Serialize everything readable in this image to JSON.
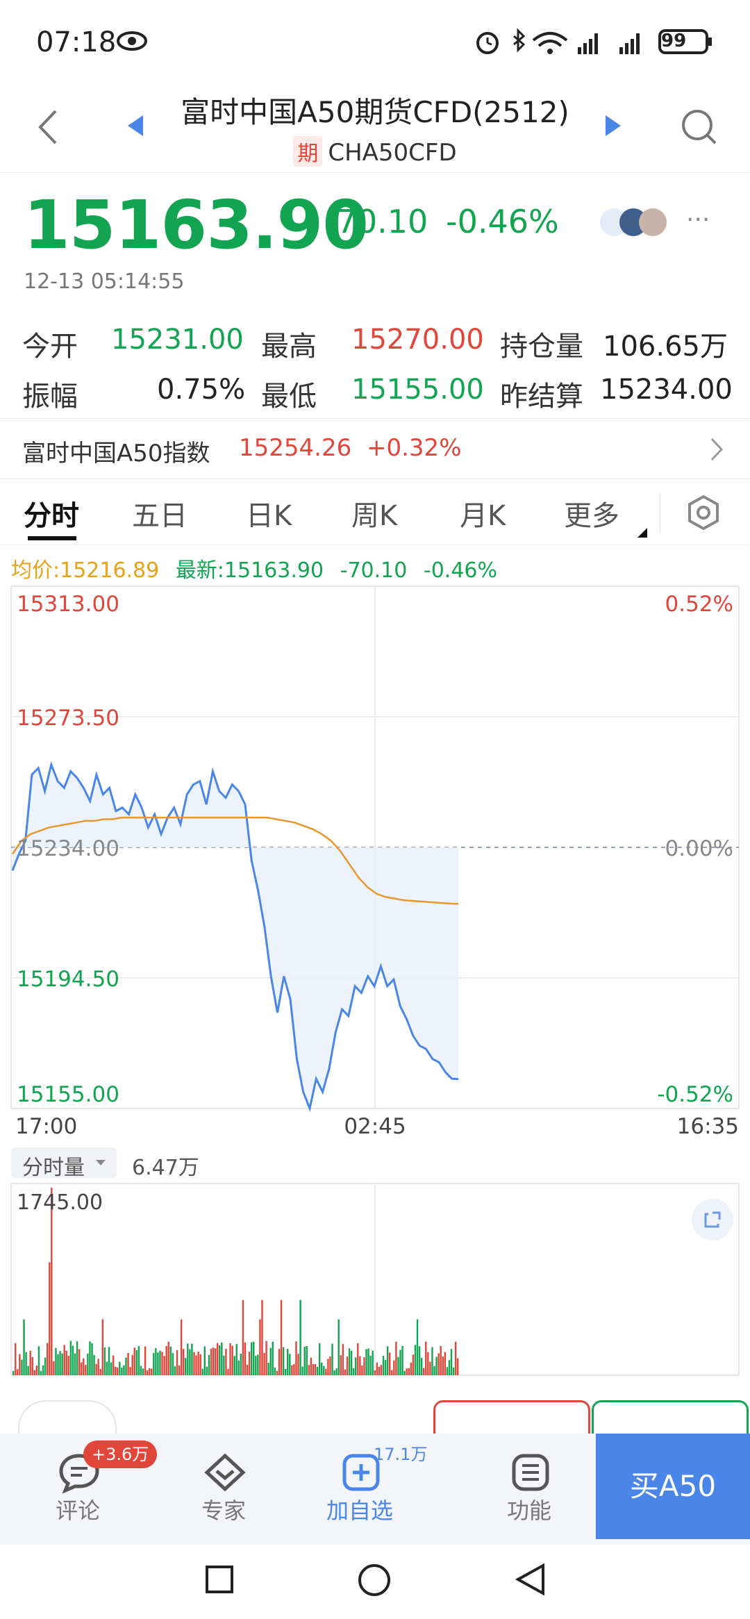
{
  "status_bar": {
    "time": "07:18",
    "battery": "99"
  },
  "header": {
    "title": "富时中国A50期货CFD(2512)",
    "badge": "期",
    "symbol": "CHA50CFD"
  },
  "quote": {
    "price": "15163.90",
    "change": "-70.10",
    "change_pct": "-0.46%",
    "timestamp": "12-13 05:14:55"
  },
  "stats": {
    "open_label": "今开",
    "open": "15231.00",
    "high_label": "最高",
    "high": "15270.00",
    "oi_label": "持仓量",
    "oi": "106.65万",
    "amp_label": "振幅",
    "amp": "0.75%",
    "low_label": "最低",
    "low": "15155.00",
    "prev_label": "昨结算",
    "prev": "15234.00"
  },
  "index_row": {
    "name": "富时中国A50指数",
    "value": "15254.26",
    "pct": "+0.32%"
  },
  "tabs": [
    {
      "label": "分时"
    },
    {
      "label": "五日"
    },
    {
      "label": "日K"
    },
    {
      "label": "周K"
    },
    {
      "label": "月K"
    },
    {
      "label": "更多"
    }
  ],
  "legend": {
    "avg": "均价:15216.89",
    "latest": "最新:15163.90",
    "chg": "-70.10",
    "pct": "-0.46%"
  },
  "volume_header": {
    "selector": "分时量",
    "total": "6.47万",
    "max": "1745.00"
  },
  "colors": {
    "green": "#13a452",
    "red": "#e0473a",
    "price_line": "#4a86e8",
    "avg_line": "#e8962e",
    "brand_blue": "#4a86e8"
  },
  "chart_data": {
    "type": "line",
    "x_ticks": [
      "17:00",
      "02:45",
      "16:35"
    ],
    "y_ticks_left": [
      "15313.00",
      "15273.50",
      "15234.00",
      "15194.50",
      "15155.00"
    ],
    "y_ticks_right": [
      "0.52%",
      "",
      "0.00%",
      "",
      "-0.52%"
    ],
    "ylim": [
      15155,
      15313
    ],
    "reference": 15234.0,
    "series": [
      {
        "role": "price",
        "values": [
          15227,
          15232,
          15236,
          15256,
          15258,
          15251,
          15259,
          15254,
          15252,
          15257,
          15255,
          15252,
          15248,
          15256,
          15250,
          15252,
          15245,
          15246,
          15244,
          15250,
          15246,
          15240,
          15244,
          15238,
          15243,
          15246,
          15241,
          15250,
          15253,
          15254,
          15247,
          15257,
          15251,
          15249,
          15253,
          15251,
          15247,
          15230,
          15221,
          15210,
          15195,
          15184,
          15195,
          15188,
          15170,
          15160,
          15155,
          15164,
          15160,
          15167,
          15178,
          15185,
          15183,
          15192,
          15190,
          15195,
          15192,
          15198,
          15192,
          15194,
          15186,
          15182,
          15177,
          15174,
          15173,
          15170,
          15169,
          15166,
          15164,
          15163.9
        ]
      },
      {
        "role": "average",
        "values": [
          15232,
          15236,
          15238,
          15239,
          15240,
          15240.5,
          15241,
          15241.5,
          15242,
          15242,
          15242.5,
          15242.5,
          15243,
          15243,
          15243,
          15243,
          15243,
          15243,
          15243,
          15243,
          15243,
          15243,
          15243,
          15243,
          15243,
          15243,
          15243,
          15243,
          15243,
          15242.5,
          15242,
          15241.5,
          15240.5,
          15239.5,
          15238,
          15236,
          15233,
          15229,
          15225,
          15222,
          15220,
          15219,
          15218.5,
          15218,
          15217.8,
          15217.6,
          15217.4,
          15217.2,
          15217,
          15216.89
        ]
      }
    ],
    "volume": {
      "ylim": [
        0,
        1745
      ]
    }
  },
  "bottom_bar": {
    "comment": {
      "label": "评论",
      "badge": "+3.6万"
    },
    "expert": {
      "label": "专家"
    },
    "add": {
      "label": "加自选",
      "count": "17.1万"
    },
    "func": {
      "label": "功能"
    },
    "buy": {
      "label": "买A50"
    }
  }
}
